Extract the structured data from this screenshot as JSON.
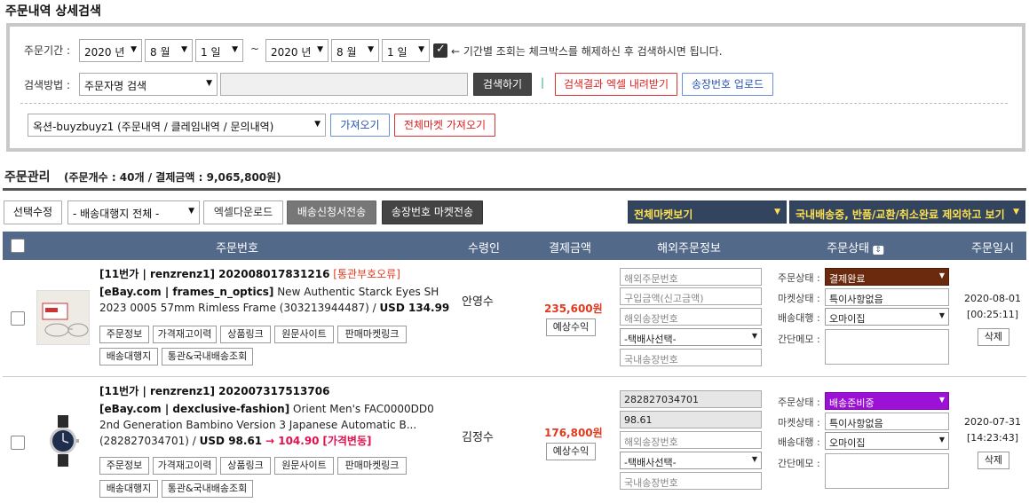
{
  "page_title": "주문내역 상세검색",
  "search": {
    "period_label": "주문기간 :",
    "start_year": "2020 년",
    "start_month": "8 월",
    "start_day": "1 일",
    "tilde": "~",
    "end_year": "2020 년",
    "end_month": "8 월",
    "end_day": "1 일",
    "period_note": "← 기간별 조회는 체크박스를 해제하신 후 검색하시면 됩니다.",
    "method_label": "검색방법 :",
    "method_value": "주문자명 검색",
    "keyword_value": "",
    "search_btn": "검색하기",
    "sep": "|",
    "excel_btn": "검색결과 엑셀 내려받기",
    "upload_btn": "송장번호 업로드",
    "market_value": "옥션-buyzbuyz1 (주문내역 / 클레임내역 / 문의내역)",
    "fetch_btn": "가져오기",
    "fetch_all_btn": "전체마켓 가져오기"
  },
  "orders": {
    "section_title": "주문관리",
    "summary": "(주문개수 : 40개 / 결제금액 : 9,065,800원)",
    "toolbar": {
      "select_edit": "선택수정",
      "agent_filter": "- 배송대행지 전체 -",
      "excel_download": "엑셀다운로드",
      "shipping_request": "배송신청서전송",
      "invoice_send": "송장번호 마켓전송",
      "market_view": "전체마켓보기",
      "exclude_view": "국내배송중, 반품/교환/취소완료 제외하고 보기"
    },
    "columns": {
      "order_no": "주문번호",
      "receiver": "수령인",
      "amount": "결제금액",
      "overseas": "해외주문정보",
      "status": "주문상태",
      "date": "주문일시"
    },
    "rows": [
      {
        "header": "[11번가 | renzrenz1] 202008017831216",
        "flag": "[통관부호오류]",
        "source": "[eBay.com | frames_n_optics]",
        "title": "New Authentic Starck Eyes SH",
        "title2": "2023 0005 57mm Rimless Frame (303213944487) /",
        "usd": "USD 134.99",
        "change": "",
        "change_flag": "",
        "buttons": [
          "주문정보",
          "가격재고이력",
          "상품링크",
          "원문사이트",
          "판매마켓링크"
        ],
        "buttons2": [
          "배송대행지",
          "통관&국내배송조회"
        ],
        "receiver": "안영수",
        "amount": "235,600원",
        "profit_btn": "예상수익",
        "overseas_order_no": "해외주문번호",
        "purchase_amount": "구입금액(신고금액)",
        "overseas_invoice": "해외송장번호",
        "courier": "-택배사선택-",
        "domestic_invoice": "국내송장번호",
        "status_label": "주문상태 :",
        "status_value": "결제완료",
        "status_color": "#6b2a0e",
        "market_label": "마켓상태 :",
        "market_value": "특이사항없음",
        "agent_label": "배송대행 :",
        "agent_value": "오마이집",
        "memo_label": "간단메모 :",
        "date": "2020-08-01",
        "time": "[00:25:11]",
        "delete_btn": "삭제"
      },
      {
        "header": "[11번가 | renzrenz1] 202007317513706",
        "flag": "",
        "source": "[eBay.com | dexclusive-fashion]",
        "title": "Orient Men's FAC0000DD0",
        "title2": "2nd Generation Bambino Version 3 Japanese Automatic B...",
        "title3": "(282827034701) /",
        "usd": "USD 98.61",
        "change": "→ 104.90",
        "change_flag": "[가격변동]",
        "buttons": [
          "주문정보",
          "가격재고이력",
          "상품링크",
          "원문사이트",
          "판매마켓링크"
        ],
        "buttons2": [
          "배송대행지",
          "통관&국내배송조회"
        ],
        "receiver": "김정수",
        "amount": "176,800원",
        "profit_btn": "예상수익",
        "overseas_order_no": "282827034701",
        "purchase_amount": "98.61",
        "overseas_invoice": "해외송장번호",
        "courier": "-택배사선택-",
        "domestic_invoice": "국내송장번호",
        "status_label": "주문상태 :",
        "status_value": "배송준비중",
        "status_color": "#9b11d6",
        "market_label": "마켓상태 :",
        "market_value": "특이사항없음",
        "agent_label": "배송대행 :",
        "agent_value": "오마이집",
        "memo_label": "간단메모 :",
        "date": "2020-07-31",
        "time": "[14:23:43]",
        "delete_btn": "삭제"
      }
    ]
  }
}
